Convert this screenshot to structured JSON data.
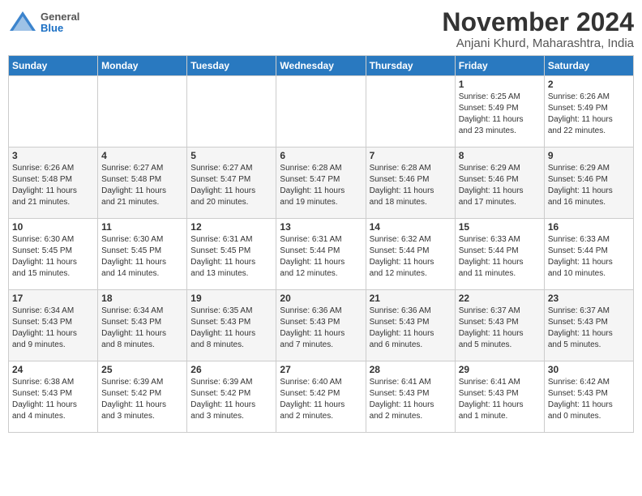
{
  "header": {
    "logo_general": "General",
    "logo_blue": "Blue",
    "month_title": "November 2024",
    "location": "Anjani Khurd, Maharashtra, India"
  },
  "weekdays": [
    "Sunday",
    "Monday",
    "Tuesday",
    "Wednesday",
    "Thursday",
    "Friday",
    "Saturday"
  ],
  "weeks": [
    [
      {
        "day": "",
        "info": ""
      },
      {
        "day": "",
        "info": ""
      },
      {
        "day": "",
        "info": ""
      },
      {
        "day": "",
        "info": ""
      },
      {
        "day": "",
        "info": ""
      },
      {
        "day": "1",
        "info": "Sunrise: 6:25 AM\nSunset: 5:49 PM\nDaylight: 11 hours\nand 23 minutes."
      },
      {
        "day": "2",
        "info": "Sunrise: 6:26 AM\nSunset: 5:49 PM\nDaylight: 11 hours\nand 22 minutes."
      }
    ],
    [
      {
        "day": "3",
        "info": "Sunrise: 6:26 AM\nSunset: 5:48 PM\nDaylight: 11 hours\nand 21 minutes."
      },
      {
        "day": "4",
        "info": "Sunrise: 6:27 AM\nSunset: 5:48 PM\nDaylight: 11 hours\nand 21 minutes."
      },
      {
        "day": "5",
        "info": "Sunrise: 6:27 AM\nSunset: 5:47 PM\nDaylight: 11 hours\nand 20 minutes."
      },
      {
        "day": "6",
        "info": "Sunrise: 6:28 AM\nSunset: 5:47 PM\nDaylight: 11 hours\nand 19 minutes."
      },
      {
        "day": "7",
        "info": "Sunrise: 6:28 AM\nSunset: 5:46 PM\nDaylight: 11 hours\nand 18 minutes."
      },
      {
        "day": "8",
        "info": "Sunrise: 6:29 AM\nSunset: 5:46 PM\nDaylight: 11 hours\nand 17 minutes."
      },
      {
        "day": "9",
        "info": "Sunrise: 6:29 AM\nSunset: 5:46 PM\nDaylight: 11 hours\nand 16 minutes."
      }
    ],
    [
      {
        "day": "10",
        "info": "Sunrise: 6:30 AM\nSunset: 5:45 PM\nDaylight: 11 hours\nand 15 minutes."
      },
      {
        "day": "11",
        "info": "Sunrise: 6:30 AM\nSunset: 5:45 PM\nDaylight: 11 hours\nand 14 minutes."
      },
      {
        "day": "12",
        "info": "Sunrise: 6:31 AM\nSunset: 5:45 PM\nDaylight: 11 hours\nand 13 minutes."
      },
      {
        "day": "13",
        "info": "Sunrise: 6:31 AM\nSunset: 5:44 PM\nDaylight: 11 hours\nand 12 minutes."
      },
      {
        "day": "14",
        "info": "Sunrise: 6:32 AM\nSunset: 5:44 PM\nDaylight: 11 hours\nand 12 minutes."
      },
      {
        "day": "15",
        "info": "Sunrise: 6:33 AM\nSunset: 5:44 PM\nDaylight: 11 hours\nand 11 minutes."
      },
      {
        "day": "16",
        "info": "Sunrise: 6:33 AM\nSunset: 5:44 PM\nDaylight: 11 hours\nand 10 minutes."
      }
    ],
    [
      {
        "day": "17",
        "info": "Sunrise: 6:34 AM\nSunset: 5:43 PM\nDaylight: 11 hours\nand 9 minutes."
      },
      {
        "day": "18",
        "info": "Sunrise: 6:34 AM\nSunset: 5:43 PM\nDaylight: 11 hours\nand 8 minutes."
      },
      {
        "day": "19",
        "info": "Sunrise: 6:35 AM\nSunset: 5:43 PM\nDaylight: 11 hours\nand 8 minutes."
      },
      {
        "day": "20",
        "info": "Sunrise: 6:36 AM\nSunset: 5:43 PM\nDaylight: 11 hours\nand 7 minutes."
      },
      {
        "day": "21",
        "info": "Sunrise: 6:36 AM\nSunset: 5:43 PM\nDaylight: 11 hours\nand 6 minutes."
      },
      {
        "day": "22",
        "info": "Sunrise: 6:37 AM\nSunset: 5:43 PM\nDaylight: 11 hours\nand 5 minutes."
      },
      {
        "day": "23",
        "info": "Sunrise: 6:37 AM\nSunset: 5:43 PM\nDaylight: 11 hours\nand 5 minutes."
      }
    ],
    [
      {
        "day": "24",
        "info": "Sunrise: 6:38 AM\nSunset: 5:43 PM\nDaylight: 11 hours\nand 4 minutes."
      },
      {
        "day": "25",
        "info": "Sunrise: 6:39 AM\nSunset: 5:42 PM\nDaylight: 11 hours\nand 3 minutes."
      },
      {
        "day": "26",
        "info": "Sunrise: 6:39 AM\nSunset: 5:42 PM\nDaylight: 11 hours\nand 3 minutes."
      },
      {
        "day": "27",
        "info": "Sunrise: 6:40 AM\nSunset: 5:42 PM\nDaylight: 11 hours\nand 2 minutes."
      },
      {
        "day": "28",
        "info": "Sunrise: 6:41 AM\nSunset: 5:43 PM\nDaylight: 11 hours\nand 2 minutes."
      },
      {
        "day": "29",
        "info": "Sunrise: 6:41 AM\nSunset: 5:43 PM\nDaylight: 11 hours\nand 1 minute."
      },
      {
        "day": "30",
        "info": "Sunrise: 6:42 AM\nSunset: 5:43 PM\nDaylight: 11 hours\nand 0 minutes."
      }
    ]
  ]
}
